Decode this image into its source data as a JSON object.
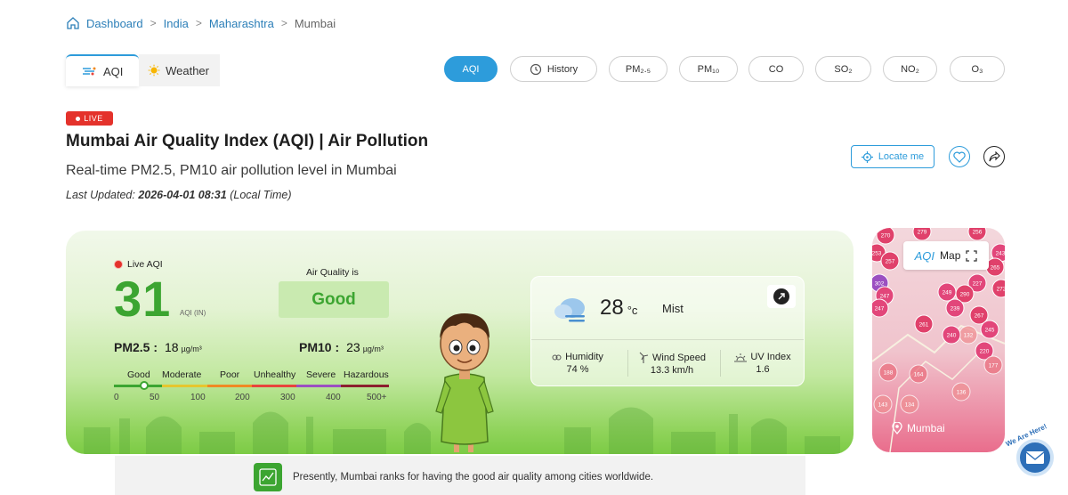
{
  "breadcrumb": {
    "items": [
      "Dashboard",
      "India",
      "Maharashtra"
    ],
    "current": "Mumbai"
  },
  "tabs": [
    {
      "label": "AQI",
      "icon": "aqi-wind-icon",
      "active": true
    },
    {
      "label": "Weather",
      "icon": "sun-icon",
      "active": false
    }
  ],
  "pills": [
    {
      "label": "AQI",
      "active": true
    },
    {
      "label": "History",
      "icon": "history-icon"
    },
    {
      "label": "PM₂.₅"
    },
    {
      "label": "PM₁₀"
    },
    {
      "label": "CO"
    },
    {
      "label": "SO₂"
    },
    {
      "label": "NO₂"
    },
    {
      "label": "O₃"
    }
  ],
  "live_badge": "LIVE",
  "title": "Mumbai Air Quality Index (AQI) | Air Pollution",
  "subtitle": "Real-time PM2.5, PM10 air pollution level in Mumbai",
  "updated": {
    "prefix": "Last Updated:",
    "datetime": "2026-04-01 08:31",
    "suffix": "(Local Time)"
  },
  "actions": {
    "locate": "Locate me"
  },
  "aqi_card": {
    "live_label": "Live AQI",
    "value": "31",
    "unit": "AQI (IN)",
    "quality_label": "Air Quality is",
    "quality": "Good",
    "pm25_label": "PM2.5 :",
    "pm25_value": "18",
    "pm10_label": "PM10 :",
    "pm10_value": "23",
    "pm_unit": "µg/m³",
    "scale_labels": [
      "Good",
      "Moderate",
      "Poor",
      "Unhealthy",
      "Severe",
      "Hazardous"
    ],
    "scale_numbers": [
      "0",
      "50",
      "100",
      "200",
      "300",
      "400",
      "500+"
    ],
    "scale_colors": [
      "#3ca531",
      "#e6c62e",
      "#f08a24",
      "#e8453c",
      "#9b4fc1",
      "#8c1f2e"
    ]
  },
  "weather": {
    "temp": "28",
    "temp_unit": "°c",
    "condition": "Mist",
    "humidity_label": "Humidity",
    "humidity": "74 %",
    "wind_label": "Wind Speed",
    "wind": "13.3 km/h",
    "uv_label": "UV Index",
    "uv": "1.6"
  },
  "map": {
    "logo": "AQI",
    "label": "Map",
    "city": "Mumbai",
    "markers": [
      "270",
      "279",
      "256",
      "253",
      "257",
      "243",
      "265",
      "227",
      "272",
      "302",
      "247",
      "249",
      "290",
      "247",
      "239",
      "267",
      "261",
      "132",
      "245",
      "240",
      "220",
      "177",
      "164",
      "188",
      "136",
      "143",
      "134"
    ]
  },
  "info": {
    "text": "Presently, Mumbai ranks for having the good air quality among cities worldwide."
  },
  "contact": {
    "label": "We Are Here!"
  }
}
